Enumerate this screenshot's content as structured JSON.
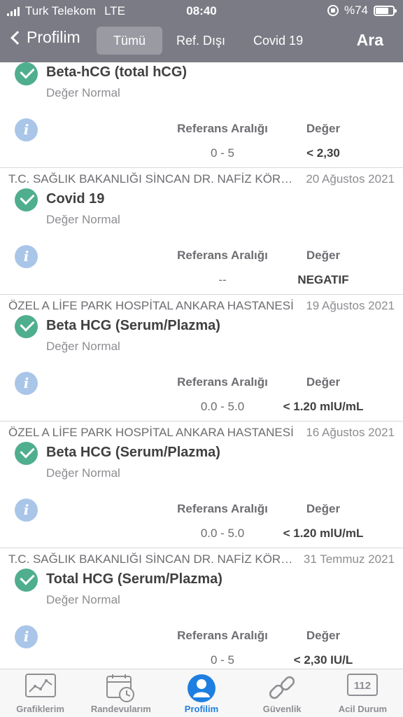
{
  "status_bar": {
    "carrier": "Turk Telekom",
    "network": "LTE",
    "time": "08:40",
    "battery": "%74",
    "battery_level": 0.74
  },
  "nav": {
    "back_label": "Profilim",
    "tabs": [
      "Tümü",
      "Ref. Dışı",
      "Covid 19"
    ],
    "active_tab": "Tümü",
    "search_label": "Ara"
  },
  "table_headers": {
    "ref": "Referans Aralığı",
    "value": "Değer"
  },
  "results": [
    {
      "institution": "",
      "date": "",
      "test": "Beta-hCG (total hCG)",
      "status": "Değer Normal",
      "ref_range": "0 - 5",
      "value": "< 2,30"
    },
    {
      "institution": "T.C. SAĞLIK BAKANLIĞI SİNCAN DR. NAFİZ KÖRÜ DEVLET HASTANESİ",
      "date": "20 Ağustos 2021",
      "test": "Covid 19",
      "status": "Değer Normal",
      "ref_range": "--",
      "value": "NEGATIF"
    },
    {
      "institution": "ÖZEL A LİFE PARK HOSPİTAL ANKARA HASTANESİ",
      "date": "19 Ağustos 2021",
      "test": "Beta HCG (Serum/Plazma)",
      "status": "Değer Normal",
      "ref_range": "0.0 - 5.0",
      "value": "< 1.20 mlU/mL"
    },
    {
      "institution": "ÖZEL A LİFE PARK HOSPİTAL ANKARA HASTANESİ",
      "date": "16 Ağustos 2021",
      "test": "Beta HCG (Serum/Plazma)",
      "status": "Değer Normal",
      "ref_range": "0.0 - 5.0",
      "value": "< 1.20 mlU/mL"
    },
    {
      "institution": "T.C. SAĞLIK BAKANLIĞI SİNCAN DR. NAFİZ KÖRÜ DEVLET HASTANESİ",
      "date": "31 Temmuz 2021",
      "test": "Total HCG (Serum/Plazma)",
      "status": "Değer Normal",
      "ref_range": "0 - 5",
      "value": "< 2,30 IU/L"
    }
  ],
  "tab_bar": {
    "items": [
      {
        "label": "Grafiklerim",
        "icon": "chart-icon"
      },
      {
        "label": "Randevularım",
        "icon": "calendar-clock-icon"
      },
      {
        "label": "Profilim",
        "icon": "person-icon"
      },
      {
        "label": "Güvenlik",
        "icon": "chain-link-icon"
      },
      {
        "label": "Acil Durum",
        "icon": "emergency-112-icon"
      }
    ],
    "active": "Profilim",
    "emergency_number": "112"
  },
  "colors": {
    "header": "#7b7b86",
    "active_tab_bg": "#9a9aa3",
    "check_green": "#4fae8d",
    "info_blue": "#a9c6e8",
    "accent_blue": "#1e7fe0"
  }
}
